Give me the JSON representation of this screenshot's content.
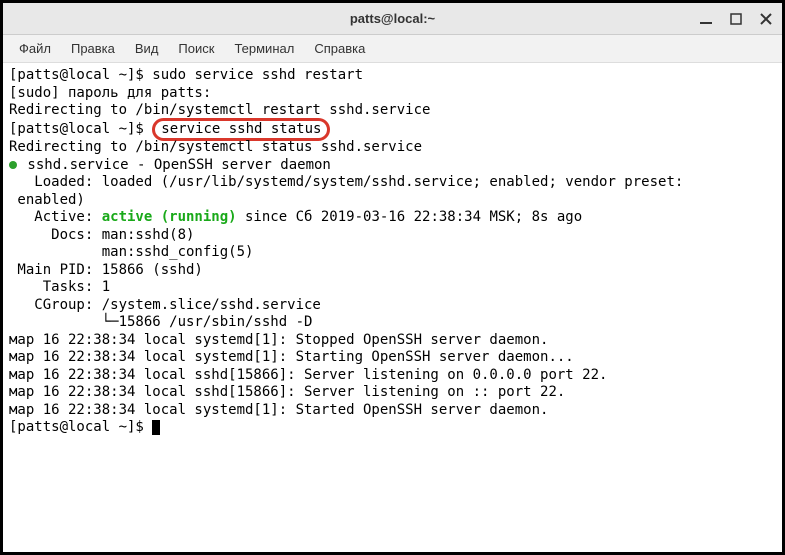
{
  "window": {
    "title": "patts@local:~"
  },
  "menu": {
    "file": "Файл",
    "edit": "Правка",
    "view": "Вид",
    "search": "Поиск",
    "terminal": "Терминал",
    "help": "Справка"
  },
  "term": {
    "prompt": "[patts@local ~]$ ",
    "l1_cmd": "sudo service sshd restart",
    "l2": "[sudo] пароль для patts:",
    "l3": "Redirecting to /bin/systemctl restart sshd.service",
    "l4_cmd": "service sshd status",
    "l5": "Redirecting to /bin/systemctl status sshd.service",
    "svc_name": " sshd.service - OpenSSH server daemon",
    "loaded": "   Loaded: loaded (/usr/lib/systemd/system/sshd.service; enabled; vendor preset:",
    "loaded2": " enabled)",
    "active_lbl": "   Active: ",
    "active_val": "active (running)",
    "active_tail": " since Сб 2019-03-16 22:38:34 MSK; 8s ago",
    "docs1": "     Docs: man:sshd(8)",
    "docs2": "           man:sshd_config(5)",
    "mainpid": " Main PID: 15866 (sshd)",
    "tasks": "    Tasks: 1",
    "cgroup1": "   CGroup: /system.slice/sshd.service",
    "cgroup2": "           └─15866 /usr/sbin/sshd -D",
    "blank": "",
    "log1": "мар 16 22:38:34 local systemd[1]: Stopped OpenSSH server daemon.",
    "log2": "мар 16 22:38:34 local systemd[1]: Starting OpenSSH server daemon...",
    "log3": "мар 16 22:38:34 local sshd[15866]: Server listening on 0.0.0.0 port 22.",
    "log4": "мар 16 22:38:34 local sshd[15866]: Server listening on :: port 22.",
    "log5": "мар 16 22:38:34 local systemd[1]: Started OpenSSH server daemon."
  }
}
